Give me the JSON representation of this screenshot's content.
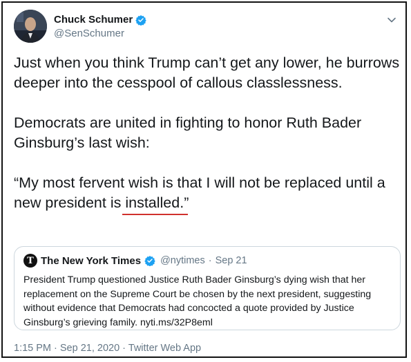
{
  "author": {
    "display_name": "Chuck Schumer",
    "handle": "@SenSchumer"
  },
  "tweet": {
    "paragraph1": "Just when you think Trump can’t get any lower, he burrows deeper into the cesspool of callous classlessness.",
    "paragraph2": "Democrats are united in fighting to honor Ruth Bader Ginsburg’s last wish:",
    "paragraph3_before": "“My most fervent wish is that I will not be replaced until a new president is ",
    "paragraph3_underlined": "installed.",
    "paragraph3_after": "”"
  },
  "quoted": {
    "name": "The New York Times",
    "handle": "@nytimes",
    "separator": "·",
    "date": "Sep 21",
    "text": "President Trump questioned Justice Ruth Bader Ginsburg’s dying wish that her replacement on the Supreme Court be chosen by the next president, suggesting without evidence that Democrats had concocted a quote provided by Justice Ginsburg’s grieving family. nyti.ms/32P8eml",
    "logo_letter": "T"
  },
  "meta": {
    "timestamp": "1:15 PM · Sep 21, 2020 · Twitter Web App"
  },
  "icons": {
    "verified": "verified-badge-icon",
    "menu": "chevron-down-icon"
  },
  "colors": {
    "verified_blue": "#1da1f2",
    "underline_red": "#d0312d",
    "secondary_text": "#657786"
  }
}
